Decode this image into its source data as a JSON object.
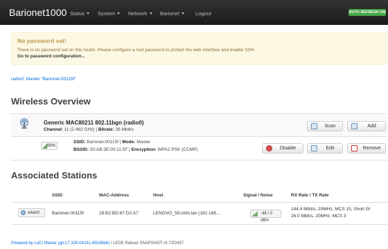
{
  "navbar": {
    "brand": "Barionet1000",
    "menu": [
      {
        "label": "Status",
        "has_caret": true
      },
      {
        "label": "System",
        "has_caret": true
      },
      {
        "label": "Network",
        "has_caret": true
      },
      {
        "label": "Barionet",
        "has_caret": true
      },
      {
        "label": "Logout",
        "has_caret": false
      }
    ],
    "auto_refresh": "AUTO REFRESH ON"
  },
  "alert": {
    "title": "No password set!",
    "text": "There is no password set on this router. Please configure a root password to protect the web interface and enable SSH.",
    "link": "Go to password configuration..."
  },
  "radio_link": "radio0: Master \"Barionet-00115f\"",
  "wireless": {
    "heading": "Wireless Overview",
    "device": {
      "name": "Generic MAC80211 802.11bgn (radio0)",
      "channel_label": "Channel:",
      "channel_value": "11 (2.462 GHz)",
      "bitrate_label": "Bitrate:",
      "bitrate_value": "26 Mbit/s",
      "scan_label": "Scan",
      "add_label": "Add"
    },
    "network": {
      "signal": "88%",
      "signal_percent": 88,
      "ssid_label": "SSID:",
      "ssid_value": "Barionet-00115f",
      "mode_label": "Mode:",
      "mode_value": "Master",
      "bssid_label": "BSSID:",
      "bssid_value": "50:AB:3E:00:11:5F",
      "encryption_label": "Encryption:",
      "encryption_value": "WPA2 PSK (CCMP)",
      "disable_label": "Disable",
      "edit_label": "Edit",
      "remove_label": "Remove"
    }
  },
  "stations": {
    "heading": "Associated Stations",
    "columns": [
      "SSID",
      "MAC-Address",
      "Host",
      "Signal / Noise",
      "RX Rate / TX Rate"
    ],
    "rows": [
      {
        "iface": "wlan0",
        "ssid": "Barionet-00115f",
        "mac": "28:B2:BD:67:D2:A7",
        "host": "LENOVO_SILVAN.lan (192.168....",
        "signal": "-48 / 0 dBm",
        "rx_rate": "144.4 Mbit/s, 20MHz, MCS 15, Short GI",
        "tx_rate": "26.0 Mbit/s, 20MHz, MCS 3"
      }
    ]
  },
  "footer": {
    "link": "Powered by LuCI Master (git-17.328.04231-802d5b6)",
    "rest": " / LEDE Reboot SNAPSHOT r0-72f2457"
  },
  "colors": {
    "navbar": "#222222",
    "alert_bg": "#fcf8e3",
    "alert_title": "#c09853",
    "link": "#0069d6",
    "auto_refresh": "#46a546"
  }
}
